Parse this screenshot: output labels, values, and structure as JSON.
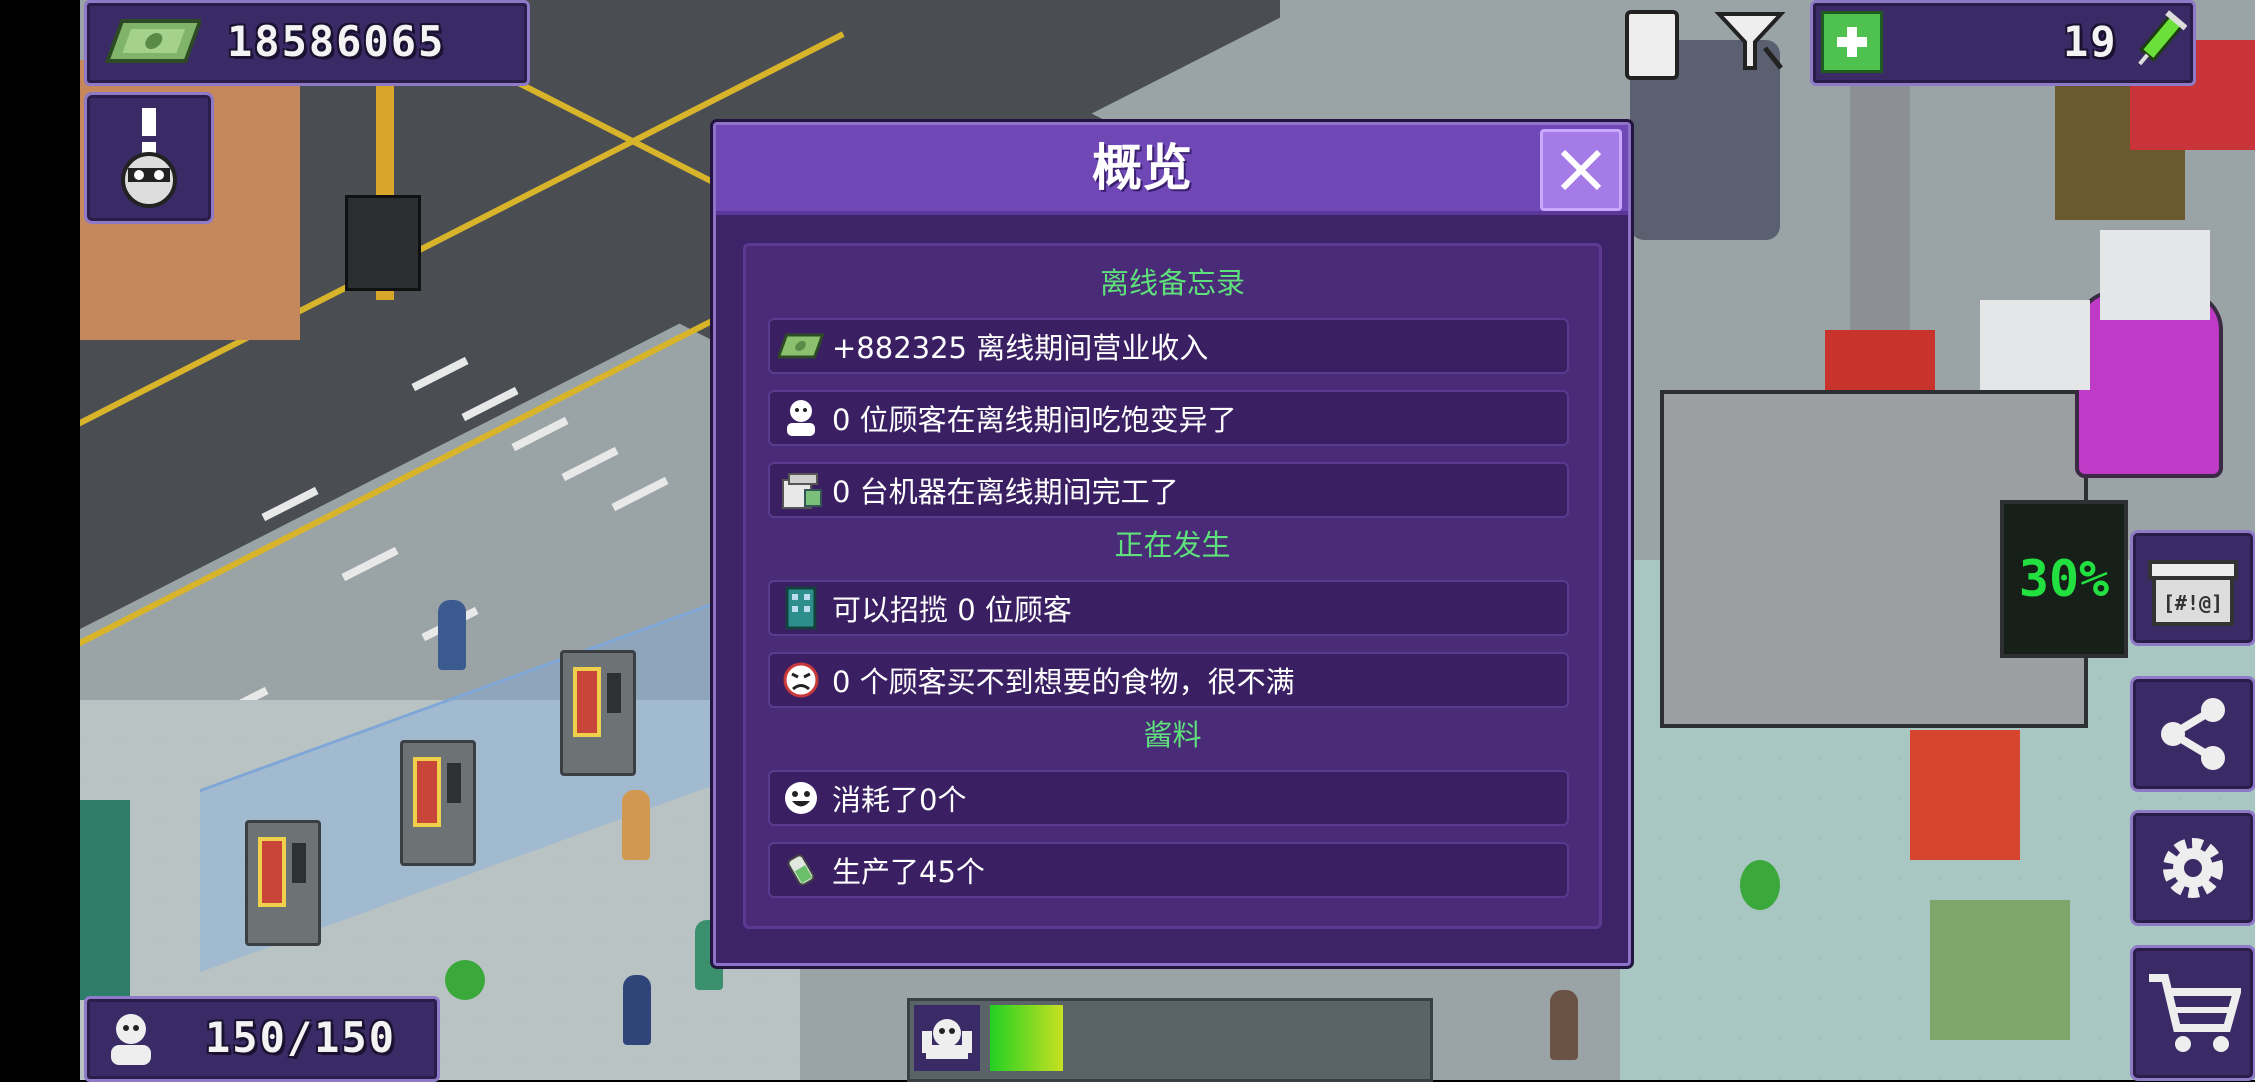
{
  "hud": {
    "money": "18586065",
    "tokens": "19",
    "customers": "150/150"
  },
  "dialog": {
    "title": "概览",
    "sections": [
      {
        "title": "离线备忘录",
        "rows": [
          {
            "icon": "money-icon",
            "text": "+882325 离线期间营业收入"
          },
          {
            "icon": "customer-icon",
            "text": "0 位顾客在离线期间吃饱变异了"
          },
          {
            "icon": "machine-icon",
            "text": "0 台机器在离线期间完工了"
          }
        ]
      },
      {
        "title": "正在发生",
        "rows": [
          {
            "icon": "building-icon",
            "text": "可以招揽 0 位顾客"
          },
          {
            "icon": "angry-face-icon",
            "text": "0 个顾客买不到想要的食物，很不满"
          }
        ]
      },
      {
        "title": "酱料",
        "rows": [
          {
            "icon": "smiley-icon",
            "text": "消耗了0个"
          },
          {
            "icon": "sauce-icon",
            "text": "生产了45个"
          }
        ]
      }
    ]
  },
  "factory_display": "30%",
  "hunger_level": 0.17,
  "colors": {
    "panel_bg": "#3d2468",
    "header_bg": "#7048b6",
    "section_title": "#5ee07a",
    "hud_panel": "#3a2a66"
  }
}
